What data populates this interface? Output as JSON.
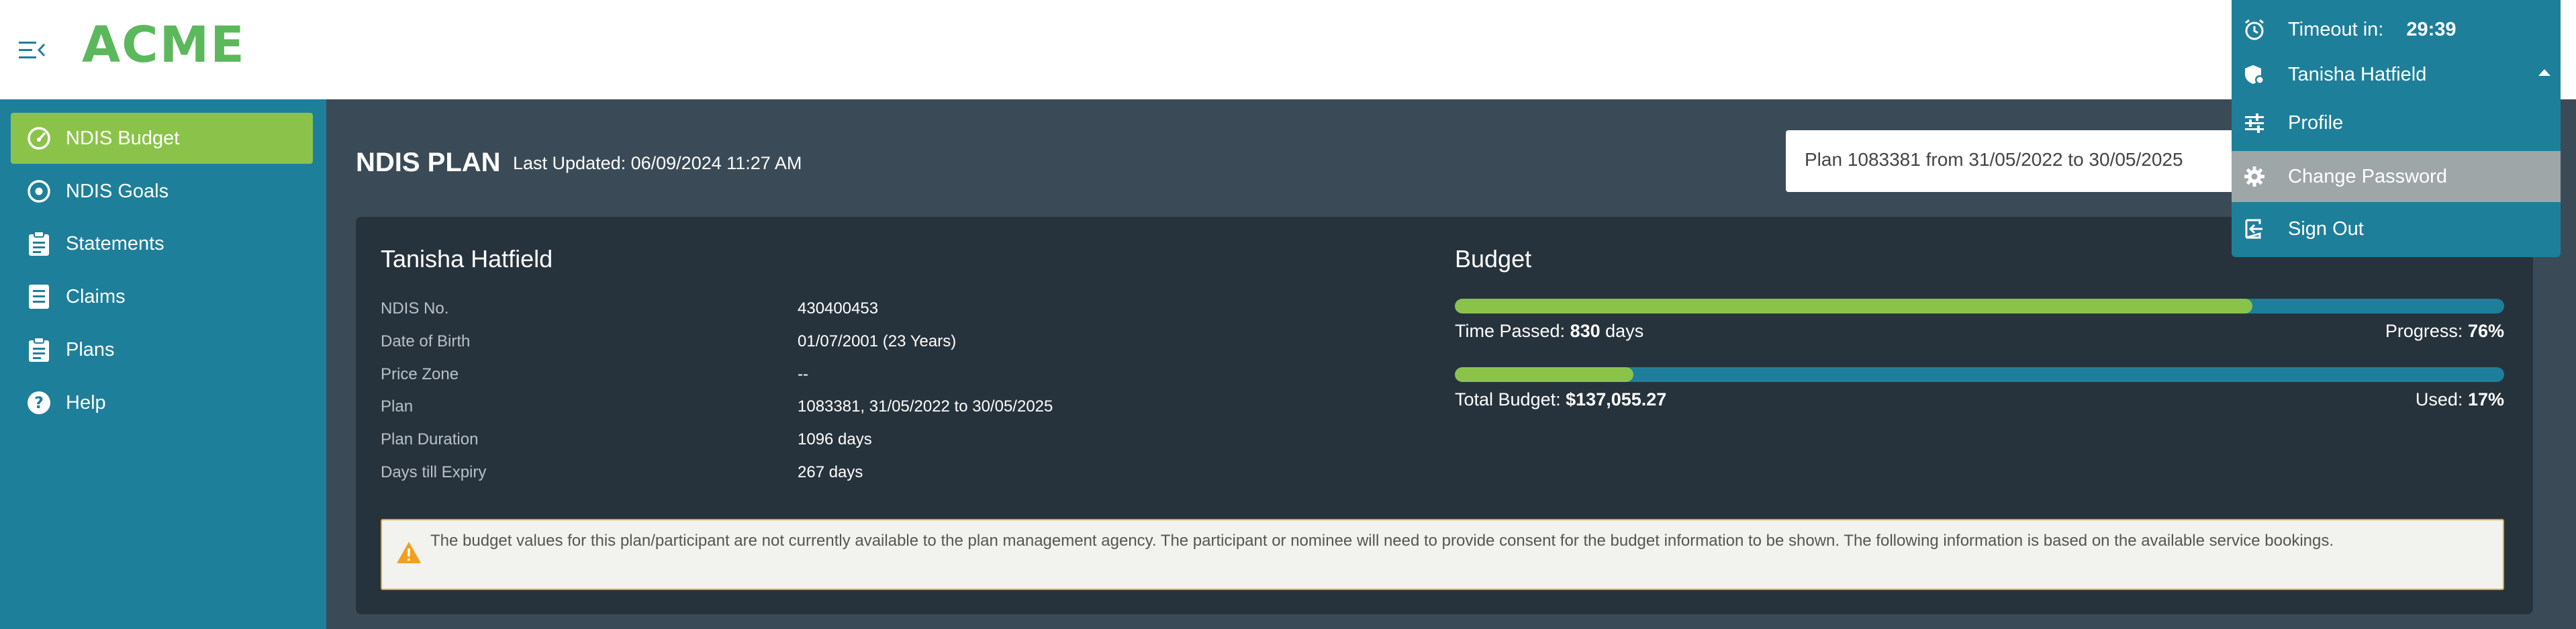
{
  "app": {
    "logo": "ACME"
  },
  "sidebar": {
    "items": [
      {
        "label": "NDIS Budget",
        "icon": "speedometer-icon",
        "active": true
      },
      {
        "label": "NDIS Goals",
        "icon": "target-icon",
        "active": false
      },
      {
        "label": "Statements",
        "icon": "clipboard-icon",
        "active": false
      },
      {
        "label": "Claims",
        "icon": "document-list-icon",
        "active": false
      },
      {
        "label": "Plans",
        "icon": "clipboard-list-icon",
        "active": false
      },
      {
        "label": "Help",
        "icon": "help-circle-icon",
        "active": false
      }
    ]
  },
  "page": {
    "title": "NDIS PLAN",
    "last_updated": "Last Updated: 06/09/2024 11:27 AM",
    "plan_select": {
      "value": "Plan 1083381 from 31/05/2022 to 30/05/2025"
    }
  },
  "participant": {
    "name": "Tanisha Hatfield",
    "details": [
      {
        "label": "NDIS No.",
        "value": "430400453"
      },
      {
        "label": "Date of Birth",
        "value": "01/07/2001 (23 Years)"
      },
      {
        "label": "Price Zone",
        "value": "--"
      },
      {
        "label": "Plan",
        "value": "1083381, 31/05/2022 to 30/05/2025"
      },
      {
        "label": "Plan Duration",
        "value": "1096 days"
      },
      {
        "label": "Days till Expiry",
        "value": "267 days"
      }
    ]
  },
  "budget": {
    "title": "Budget",
    "time_passed_label": "Time Passed:",
    "time_passed_value": "830",
    "time_passed_unit": "days",
    "progress_label": "Progress:",
    "progress_value": "76%",
    "progress_fraction": 0.76,
    "total_budget_label": "Total Budget:",
    "total_budget_value": "$137,055.27",
    "used_label": "Used:",
    "used_value": "17%",
    "used_fraction": 0.17
  },
  "notice": {
    "text": "The budget values for this plan/participant are not currently available to the plan management agency. The participant or nominee will need to provide consent for the budget information to be shown. The following information is based on the available service bookings."
  },
  "user_menu": {
    "timeout_label": "Timeout in:",
    "timeout_value": "29:39",
    "user_name": "Tanisha Hatfield",
    "items": [
      {
        "label": "Profile",
        "icon": "sliders-icon"
      },
      {
        "label": "Change Password",
        "icon": "gear-icon"
      },
      {
        "label": "Sign Out",
        "icon": "sign-out-icon"
      }
    ]
  },
  "colors": {
    "accent_green": "#8bc34a",
    "logo_green": "#5cb85c",
    "teal": "#1e7f9a",
    "card_bg": "#27333c",
    "page_bg": "#3a4b57",
    "warning": "#f0a020"
  }
}
